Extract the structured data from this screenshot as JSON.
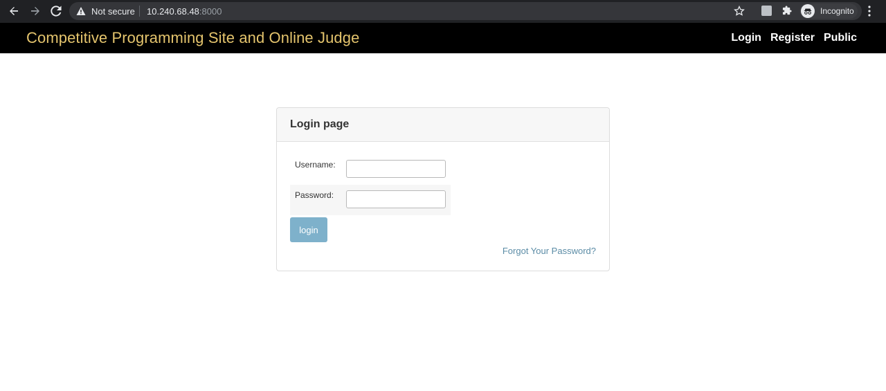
{
  "browser": {
    "security_label": "Not secure",
    "url_host": "10.240.68.48",
    "url_port": ":8000",
    "profile_label": "Incognito",
    "icons": [
      "back-arrow-icon",
      "forward-arrow-icon",
      "reload-icon",
      "warning-icon",
      "star-icon",
      "extension-icon",
      "puzzle-icon",
      "incognito-icon",
      "kebab-menu-icon"
    ]
  },
  "site_nav": {
    "brand": "Competitive Programming Site and Online Judge",
    "brand_color": "#e4c46d",
    "links": [
      {
        "label": "Login"
      },
      {
        "label": "Register"
      },
      {
        "label": "Public"
      }
    ]
  },
  "login_card": {
    "title": "Login page",
    "username_label": "Username:",
    "username_value": "",
    "password_label": "Password:",
    "password_value": "",
    "submit_label": "login",
    "forgot_link": "Forgot Your Password?",
    "button_color": "#7eb1cb",
    "link_color": "#5b8ca6"
  }
}
